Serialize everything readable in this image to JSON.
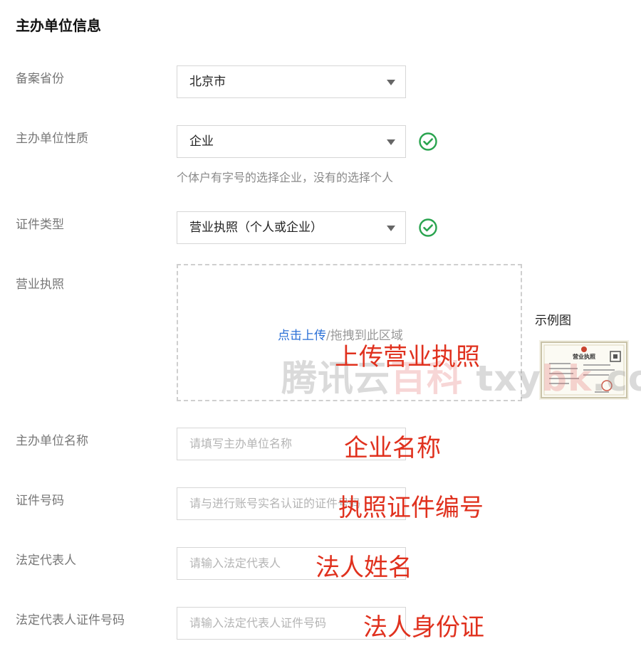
{
  "section_title": "主办单位信息",
  "fields": {
    "province": {
      "label": "备案省份",
      "value": "北京市"
    },
    "org_type": {
      "label": "主办单位性质",
      "value": "企业",
      "hint": "个体户有字号的选择企业，没有的选择个人"
    },
    "cert_type": {
      "label": "证件类型",
      "value": "营业执照（个人或企业）"
    },
    "license": {
      "label": "营业执照",
      "upload_link": "点击上传",
      "upload_rest": "/拖拽到此区域",
      "example_label": "示例图"
    },
    "org_name": {
      "label": "主办单位名称",
      "placeholder": "请填写主办单位名称"
    },
    "cert_no": {
      "label": "证件号码",
      "placeholder": "请与进行账号实名认证的证件号码"
    },
    "legal_rep": {
      "label": "法定代表人",
      "placeholder": "请输入法定代表人"
    },
    "legal_rep_id": {
      "label": "法定代表人证件号码",
      "placeholder": "请输入法定代表人证件号码"
    }
  },
  "annotations": {
    "upload": "上传营业执照",
    "org_name": "企业名称",
    "cert_no": "执照证件编号",
    "legal_rep": "法人姓名",
    "legal_rep_id": "法人身份证"
  },
  "watermark": {
    "part1": "腾讯云",
    "part2": "百科",
    "part3": " txy",
    "part4": "bk",
    "part5": ".com"
  },
  "example_thumb_title": "营业执照",
  "colors": {
    "link": "#2a6fd6",
    "success": "#2aa44f",
    "annotation": "#e0311e"
  }
}
